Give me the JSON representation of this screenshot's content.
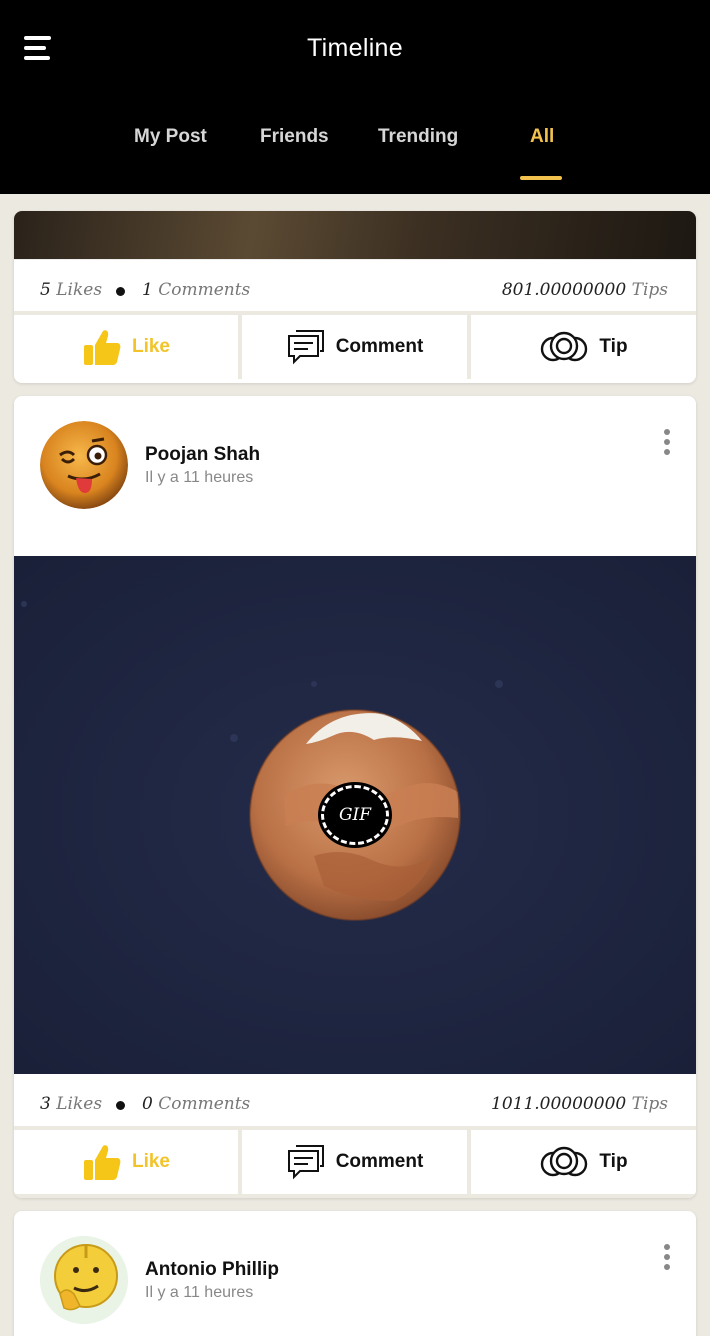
{
  "header": {
    "title": "Timeline",
    "tabs": [
      {
        "label": "My Post",
        "active": false
      },
      {
        "label": "Friends",
        "active": false
      },
      {
        "label": "Trending",
        "active": false
      },
      {
        "label": "All",
        "active": true
      }
    ]
  },
  "colors": {
    "accent": "#f2c14e",
    "header_bg": "#000000",
    "page_bg": "#ece9e1",
    "like_color": "#f2c42a"
  },
  "posts": [
    {
      "stats": {
        "likes_count": "5",
        "likes_word": "Likes",
        "comments_count": "1",
        "comments_word": "Comments",
        "tips_amount": "801.00000000",
        "tips_word": "Tips"
      },
      "actions": {
        "like": "Like",
        "comment": "Comment",
        "tip": "Tip"
      }
    },
    {
      "author": "Poojan Shah",
      "time": "Il y a 11 heures",
      "avatar_icon": "winking-tongue-emoji-icon",
      "media": {
        "badge": "GIF"
      },
      "stats": {
        "likes_count": "3",
        "likes_word": "Likes",
        "comments_count": "0",
        "comments_word": "Comments",
        "tips_amount": "1011.00000000",
        "tips_word": "Tips"
      },
      "actions": {
        "like": "Like",
        "comment": "Comment",
        "tip": "Tip"
      }
    },
    {
      "author": "Antonio Phillip",
      "time": "Il y a 11 heures",
      "avatar_icon": "thinking-emoji-icon"
    }
  ]
}
